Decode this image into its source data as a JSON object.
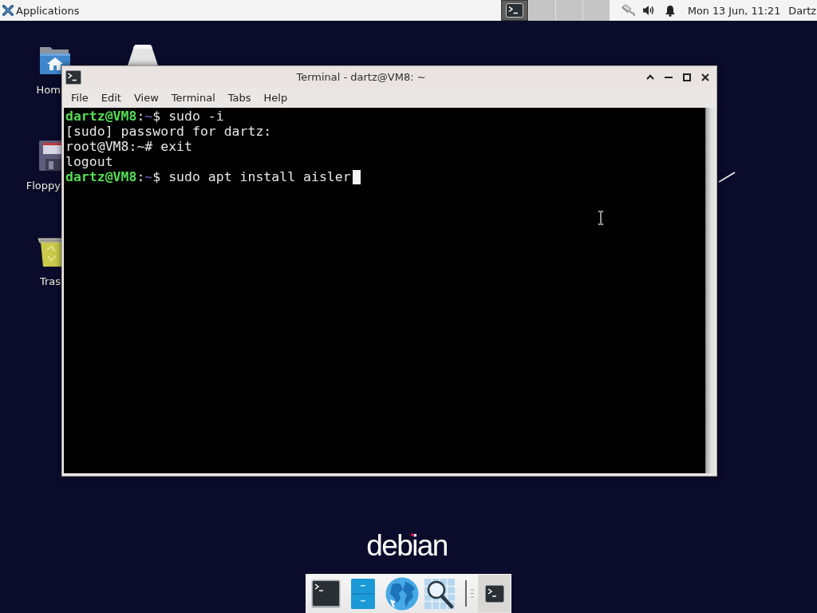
{
  "top_panel": {
    "menu_label": "Applications",
    "workspaces": [
      {
        "selected": true,
        "window_icon": true
      },
      {
        "selected": false,
        "window_icon": false
      },
      {
        "selected": false,
        "window_icon": false
      },
      {
        "selected": false,
        "window_icon": false
      }
    ],
    "clock": "Mon 13 Jun, 11:21",
    "user": "Dartz"
  },
  "desktop_icons": [
    {
      "kind": "home",
      "label": "Hom"
    },
    {
      "kind": "drive"
    },
    {
      "kind": "floppy",
      "label": "Floppy"
    },
    {
      "kind": "trash",
      "label": "Tras"
    }
  ],
  "terminal": {
    "title": "Terminal - dartz@VM8: ~",
    "menu": [
      "File",
      "Edit",
      "View",
      "Terminal",
      "Tabs",
      "Help"
    ],
    "lines": [
      {
        "kind": "prompt",
        "user_host": "dartz@VM8",
        "separator": ":",
        "path": "~",
        "symbol": "$",
        "command": "sudo -i",
        "cursor": false
      },
      {
        "kind": "output",
        "text": "[sudo] password for dartz:",
        "cursor": false
      },
      {
        "kind": "output",
        "text": "root@VM8:~# exit",
        "cursor": false
      },
      {
        "kind": "output",
        "text": "logout",
        "cursor": false
      },
      {
        "kind": "prompt",
        "user_host": "dartz@VM8",
        "separator": ":",
        "path": "~",
        "symbol": "$",
        "command": "sudo apt install aisler",
        "cursor": true
      }
    ]
  },
  "wallpaper": {
    "logo": "debian"
  },
  "dock": {
    "windows": [
      {
        "selected": true
      }
    ]
  }
}
